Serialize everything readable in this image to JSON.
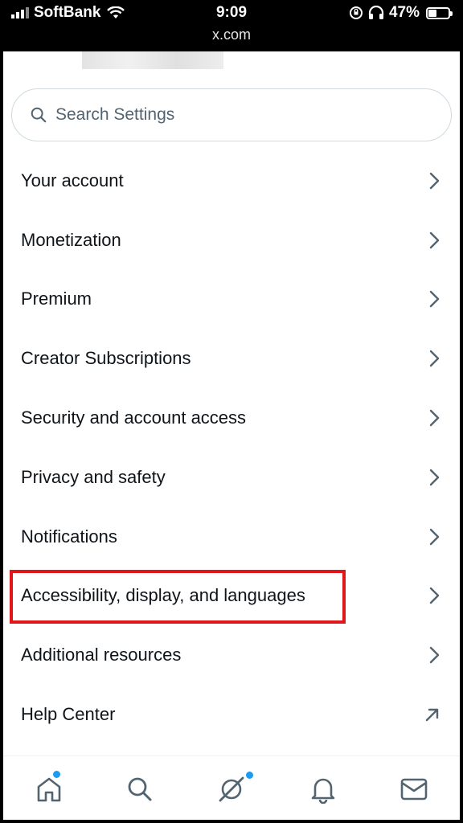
{
  "status_bar": {
    "carrier": "SoftBank",
    "time": "9:09",
    "url": "x.com",
    "battery_percent": "47%",
    "battery_level": 0.47
  },
  "search": {
    "placeholder": "Search Settings"
  },
  "menu": [
    {
      "label": "Your account",
      "icon": "chevron-right-icon"
    },
    {
      "label": "Monetization",
      "icon": "chevron-right-icon"
    },
    {
      "label": "Premium",
      "icon": "chevron-right-icon"
    },
    {
      "label": "Creator Subscriptions",
      "icon": "chevron-right-icon"
    },
    {
      "label": "Security and account access",
      "icon": "chevron-right-icon"
    },
    {
      "label": "Privacy and safety",
      "icon": "chevron-right-icon"
    },
    {
      "label": "Notifications",
      "icon": "chevron-right-icon"
    },
    {
      "label": "Accessibility, display, and languages",
      "icon": "chevron-right-icon"
    },
    {
      "label": "Additional resources",
      "icon": "chevron-right-icon"
    },
    {
      "label": "Help Center",
      "icon": "external-link-icon"
    }
  ],
  "highlighted_item": 7,
  "colors": {
    "highlight_border": "#e0161b",
    "accent_dot": "#1d9bf0",
    "text_primary": "#0f1419",
    "icon_gray": "#536471"
  },
  "tabs": [
    "home-icon",
    "search-icon",
    "grok-icon",
    "bell-icon",
    "mail-icon"
  ]
}
